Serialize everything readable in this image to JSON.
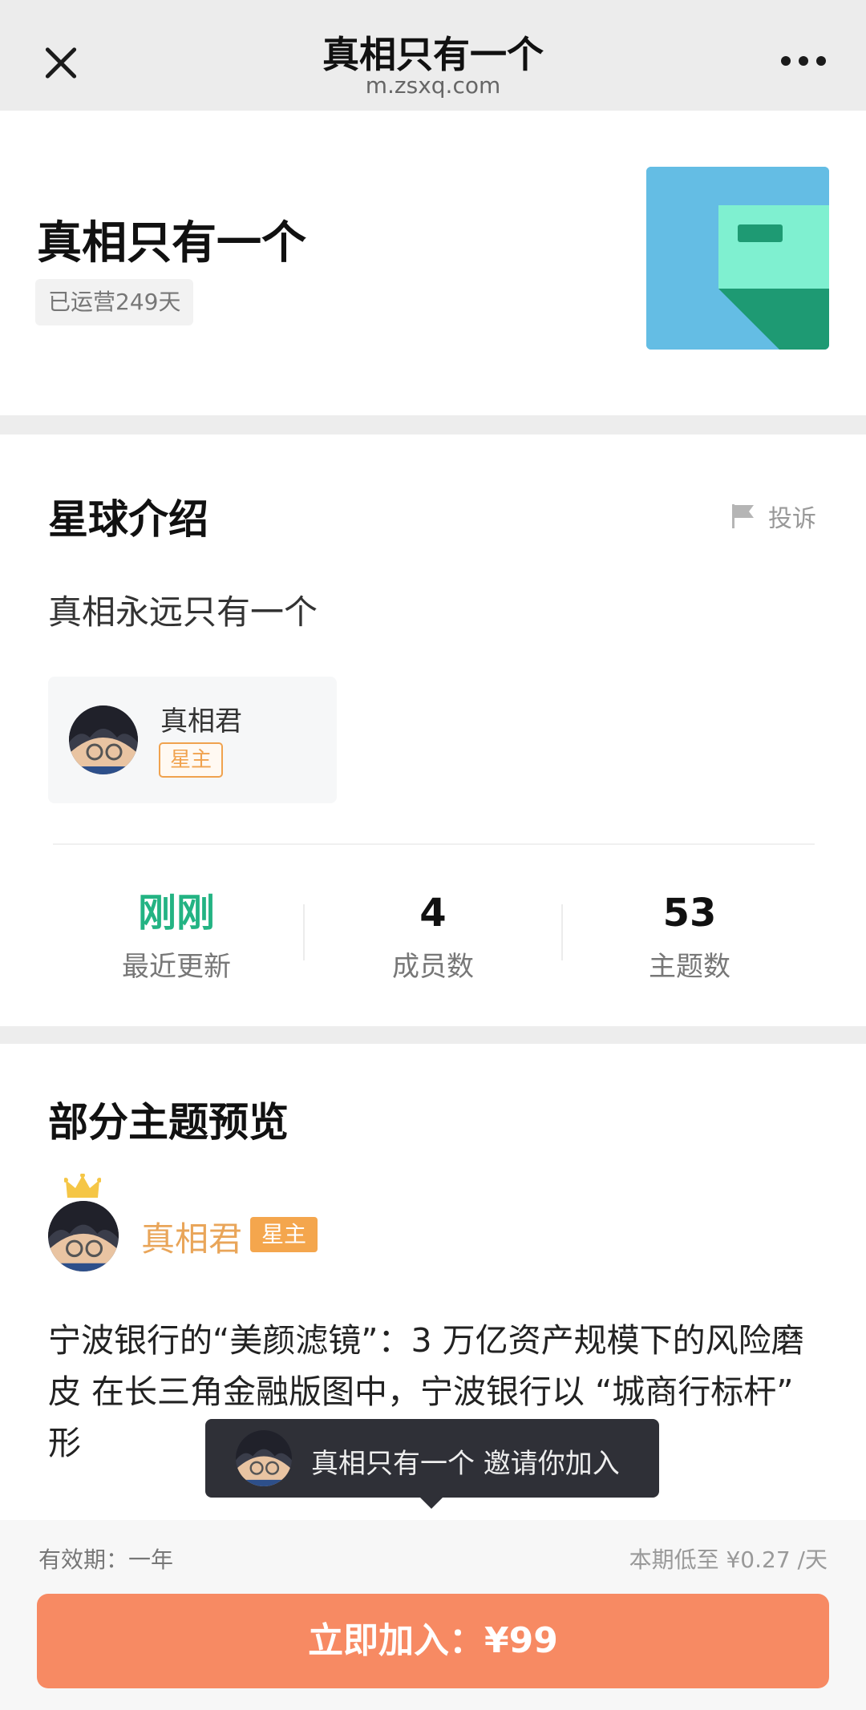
{
  "nav": {
    "title": "真相只有一个",
    "url": "m.zsxq.com"
  },
  "header": {
    "group_name": "真相只有一个",
    "age_badge": "已运营249天"
  },
  "intro": {
    "title": "星球介绍",
    "report_label": "投诉",
    "description": "真相永远只有一个",
    "owner": {
      "name": "真相君",
      "tag": "星主"
    },
    "stats": [
      {
        "value": "刚刚",
        "label": "最近更新"
      },
      {
        "value": "4",
        "label": "成员数"
      },
      {
        "value": "53",
        "label": "主题数"
      }
    ]
  },
  "preview": {
    "title": "部分主题预览",
    "topic": {
      "author": "真相君",
      "tag": "星主",
      "text": "宁波银行的“美颜滤镜”：3 万亿资产规模下的风险磨皮 在长三角金融版图中，宁波银行以 “城商行标杆” 形"
    }
  },
  "toast": {
    "text": "真相只有一个 邀请你加入"
  },
  "bottom": {
    "validity": "有效期：一年",
    "price_note": "本期低至 ¥0.27 /天",
    "join_label": "立即加入：¥99"
  },
  "colors": {
    "accent_green": "#23b383",
    "owner_orange": "#f4a64d",
    "join_button": "#f78a63",
    "cover_blue": "#64bde4",
    "cover_mint": "#7ff0d0",
    "cover_teal": "#1e9a73"
  },
  "icons": {
    "close": "close-icon",
    "more": "more-icon",
    "report": "flag-icon",
    "crown": "crown-icon"
  }
}
